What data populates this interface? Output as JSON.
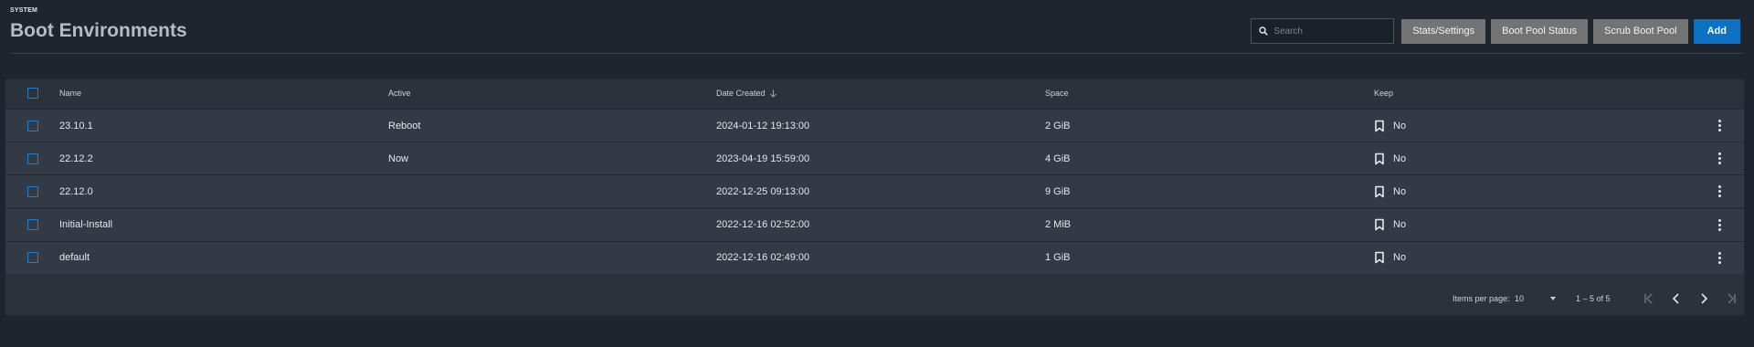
{
  "breadcrumb": "SYSTEM",
  "page_title": "Boot Environments",
  "search": {
    "placeholder": "Search",
    "value": ""
  },
  "buttons": {
    "stats_settings": "Stats/Settings",
    "boot_pool_status": "Boot Pool Status",
    "scrub_boot_pool": "Scrub Boot Pool",
    "add": "Add"
  },
  "table": {
    "columns": {
      "name": "Name",
      "active": "Active",
      "date_created": "Date Created",
      "space": "Space",
      "keep": "Keep"
    },
    "sort": {
      "column": "date_created",
      "direction": "descending"
    },
    "rows": [
      {
        "name": "23.10.1",
        "active": "Reboot",
        "date_created": "2024-01-12 19:13:00",
        "space": "2 GiB",
        "keep": "No"
      },
      {
        "name": "22.12.2",
        "active": "Now",
        "date_created": "2023-04-19 15:59:00",
        "space": "4 GiB",
        "keep": "No"
      },
      {
        "name": "22.12.0",
        "active": "",
        "date_created": "2022-12-25 09:13:00",
        "space": "9 GiB",
        "keep": "No"
      },
      {
        "name": "Initial-Install",
        "active": "",
        "date_created": "2022-12-16 02:52:00",
        "space": "2 MiB",
        "keep": "No"
      },
      {
        "name": "default",
        "active": "",
        "date_created": "2022-12-16 02:49:00",
        "space": "1 GiB",
        "keep": "No"
      }
    ]
  },
  "paginator": {
    "items_per_page_label": "Items per page:",
    "items_per_page_value": "10",
    "range_label": "1 – 5 of 5"
  },
  "colors": {
    "accent": "#0d72c4",
    "secondary_button": "#737373",
    "background": "#1f252e",
    "card": "#2a323c"
  },
  "icons": [
    "search-icon",
    "sort-down-icon",
    "bookmark-icon",
    "more-vert-icon",
    "dropdown-arrow-icon",
    "first-page-icon",
    "prev-page-icon",
    "next-page-icon",
    "last-page-icon"
  ]
}
